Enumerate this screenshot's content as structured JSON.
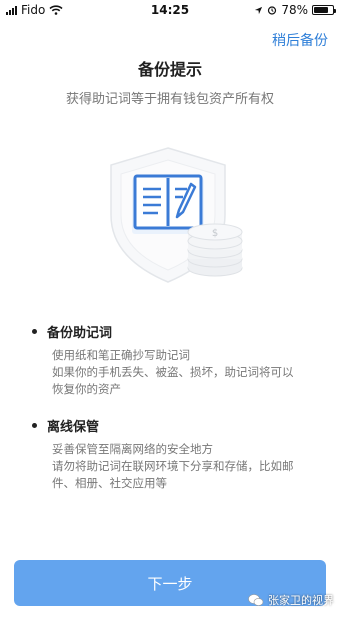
{
  "status_bar": {
    "carrier": "Fido",
    "time": "14:25",
    "battery": "78%",
    "battery_level": 0.78
  },
  "header": {
    "later_label": "稍后备份"
  },
  "main": {
    "title": "备份提示",
    "subtitle": "获得助记词等于拥有钱包资产所有权"
  },
  "sections": [
    {
      "heading": "备份助记词",
      "lines": [
        "使用纸和笔正确抄写助记词",
        "如果你的手机丢失、被盗、损坏，助记词将可以",
        "恢复你的资产"
      ]
    },
    {
      "heading": "离线保管",
      "lines": [
        "妥善保管至隔离网络的安全地方",
        "请勿将助记词在联网环境下分享和存储，比如邮",
        "件、相册、社交应用等"
      ]
    }
  ],
  "footer": {
    "next_label": "下一步"
  },
  "watermark": {
    "text": "张家卫的视界"
  },
  "colors": {
    "accent": "#2f7fd8",
    "button": "#63a4ee",
    "illustration_blue": "#3b7bd6"
  }
}
